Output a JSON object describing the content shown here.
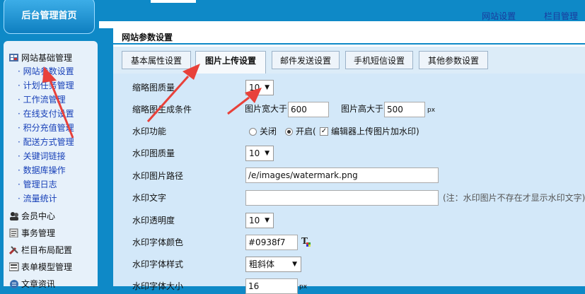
{
  "header": {
    "home_label": "后台管理首页",
    "links": [
      "网站设置",
      "栏目管理"
    ]
  },
  "sidebar": {
    "groups": [
      {
        "label": "网站基础管理",
        "icon": "gear-grid-icon"
      },
      {
        "label": "会员中心",
        "icon": "users-icon"
      },
      {
        "label": "事务管理",
        "icon": "clipboard-icon"
      },
      {
        "label": "栏目布局配置",
        "icon": "tools-icon"
      },
      {
        "label": "表单模型管理",
        "icon": "form-icon"
      },
      {
        "label": "文章资讯",
        "icon": "article-icon"
      }
    ],
    "items": [
      "网站参数设置",
      "计划任务管理",
      "工作流管理",
      "在线支付设置",
      "积分充值管理",
      "配送方式管理",
      "关键词链接",
      "数据库操作",
      "管理日志",
      "流量统计"
    ]
  },
  "main": {
    "title": "网站参数设置",
    "tabs": [
      "基本属性设置",
      "图片上传设置",
      "邮件发送设置",
      "手机短信设置",
      "其他参数设置"
    ],
    "active_tab": "图片上传设置"
  },
  "form": {
    "thumb_quality": {
      "label": "缩略图质量",
      "value": "10"
    },
    "thumb_condition": {
      "label": "缩略图生成条件",
      "width_label": "图片宽大于",
      "width_value": "600",
      "height_label": "图片高大于",
      "height_value": "500",
      "unit": "px"
    },
    "watermark": {
      "label": "水印功能",
      "off_label": "关闭",
      "on_label": "开启(",
      "editor_label": "编辑器上传图片加水印)",
      "selected": "on",
      "editor_checked": true
    },
    "wm_quality": {
      "label": "水印图质量",
      "value": "10"
    },
    "wm_path": {
      "label": "水印图片路径",
      "value": "/e/images/watermark.png"
    },
    "wm_text": {
      "label": "水印文字",
      "value": "",
      "note": "(注：水印图片不存在才显示水印文字)"
    },
    "wm_opacity": {
      "label": "水印透明度",
      "value": "10"
    },
    "wm_color": {
      "label": "水印字体颜色",
      "value": "#0938f7"
    },
    "wm_style": {
      "label": "水印字体样式",
      "value": "粗斜体"
    },
    "wm_size": {
      "label": "水印字体大小",
      "value": "16",
      "unit": "px"
    }
  },
  "colors": {
    "topbar": "#0e89c7",
    "form_bg": "#d3e8f9",
    "arrow": "#e8413a",
    "link": "#1740b8"
  }
}
